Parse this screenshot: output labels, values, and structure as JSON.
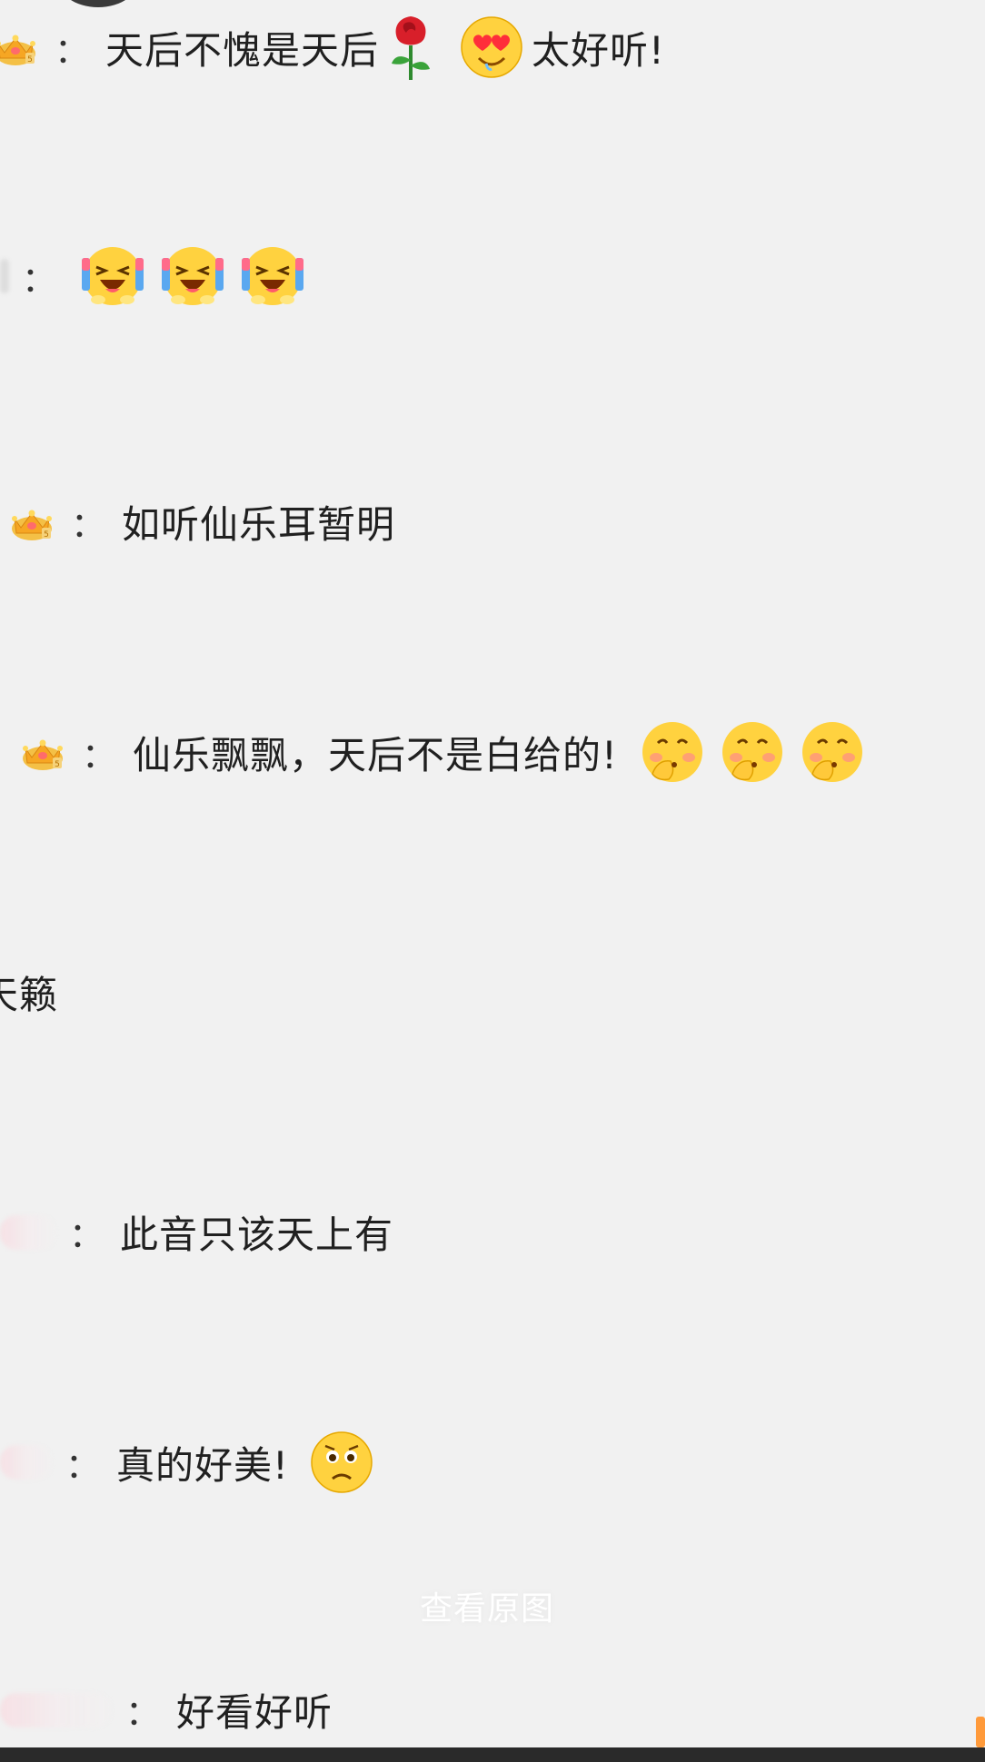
{
  "comments": [
    {
      "prefix": "：",
      "text": "天后不愧是天后",
      "suffix": "太好听!"
    },
    {
      "prefix": "：",
      "text": ""
    },
    {
      "prefix": "：",
      "text": "如听仙乐耳暂明"
    },
    {
      "prefix": "：",
      "text": "仙乐飘飘，天后不是白给的!"
    },
    {
      "prefix": "",
      "text": "天籁"
    },
    {
      "prefix": "：",
      "text": "此音只该天上有"
    },
    {
      "prefix": "：",
      "text": "真的好美!"
    },
    {
      "prefix": "：",
      "text": "好看好听"
    }
  ],
  "view_original": "查看原图",
  "icons": {
    "badge": "crown-icon",
    "rose": "rose-icon",
    "heart_eyes": "heart-eyes-emoji-icon",
    "crying_laughing": "crying-laughing-emoji-icon",
    "shy": "shy-emoji-icon",
    "pleading": "pleading-emoji-icon"
  },
  "colors": {
    "background": "#f1f1f1",
    "text": "#202020",
    "accent": "#ff9a3a"
  }
}
